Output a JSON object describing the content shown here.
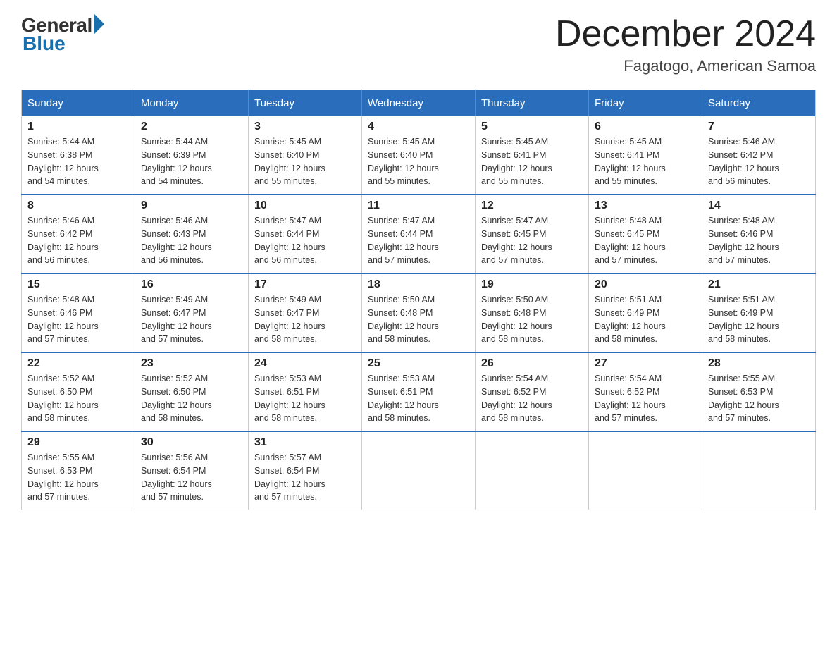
{
  "logo": {
    "general": "General",
    "blue": "Blue"
  },
  "title": {
    "month_year": "December 2024",
    "location": "Fagatogo, American Samoa"
  },
  "weekdays": [
    "Sunday",
    "Monday",
    "Tuesday",
    "Wednesday",
    "Thursday",
    "Friday",
    "Saturday"
  ],
  "weeks": [
    [
      {
        "day": "1",
        "sunrise": "5:44 AM",
        "sunset": "6:38 PM",
        "daylight": "12 hours and 54 minutes."
      },
      {
        "day": "2",
        "sunrise": "5:44 AM",
        "sunset": "6:39 PM",
        "daylight": "12 hours and 54 minutes."
      },
      {
        "day": "3",
        "sunrise": "5:45 AM",
        "sunset": "6:40 PM",
        "daylight": "12 hours and 55 minutes."
      },
      {
        "day": "4",
        "sunrise": "5:45 AM",
        "sunset": "6:40 PM",
        "daylight": "12 hours and 55 minutes."
      },
      {
        "day": "5",
        "sunrise": "5:45 AM",
        "sunset": "6:41 PM",
        "daylight": "12 hours and 55 minutes."
      },
      {
        "day": "6",
        "sunrise": "5:45 AM",
        "sunset": "6:41 PM",
        "daylight": "12 hours and 55 minutes."
      },
      {
        "day": "7",
        "sunrise": "5:46 AM",
        "sunset": "6:42 PM",
        "daylight": "12 hours and 56 minutes."
      }
    ],
    [
      {
        "day": "8",
        "sunrise": "5:46 AM",
        "sunset": "6:42 PM",
        "daylight": "12 hours and 56 minutes."
      },
      {
        "day": "9",
        "sunrise": "5:46 AM",
        "sunset": "6:43 PM",
        "daylight": "12 hours and 56 minutes."
      },
      {
        "day": "10",
        "sunrise": "5:47 AM",
        "sunset": "6:44 PM",
        "daylight": "12 hours and 56 minutes."
      },
      {
        "day": "11",
        "sunrise": "5:47 AM",
        "sunset": "6:44 PM",
        "daylight": "12 hours and 57 minutes."
      },
      {
        "day": "12",
        "sunrise": "5:47 AM",
        "sunset": "6:45 PM",
        "daylight": "12 hours and 57 minutes."
      },
      {
        "day": "13",
        "sunrise": "5:48 AM",
        "sunset": "6:45 PM",
        "daylight": "12 hours and 57 minutes."
      },
      {
        "day": "14",
        "sunrise": "5:48 AM",
        "sunset": "6:46 PM",
        "daylight": "12 hours and 57 minutes."
      }
    ],
    [
      {
        "day": "15",
        "sunrise": "5:48 AM",
        "sunset": "6:46 PM",
        "daylight": "12 hours and 57 minutes."
      },
      {
        "day": "16",
        "sunrise": "5:49 AM",
        "sunset": "6:47 PM",
        "daylight": "12 hours and 57 minutes."
      },
      {
        "day": "17",
        "sunrise": "5:49 AM",
        "sunset": "6:47 PM",
        "daylight": "12 hours and 58 minutes."
      },
      {
        "day": "18",
        "sunrise": "5:50 AM",
        "sunset": "6:48 PM",
        "daylight": "12 hours and 58 minutes."
      },
      {
        "day": "19",
        "sunrise": "5:50 AM",
        "sunset": "6:48 PM",
        "daylight": "12 hours and 58 minutes."
      },
      {
        "day": "20",
        "sunrise": "5:51 AM",
        "sunset": "6:49 PM",
        "daylight": "12 hours and 58 minutes."
      },
      {
        "day": "21",
        "sunrise": "5:51 AM",
        "sunset": "6:49 PM",
        "daylight": "12 hours and 58 minutes."
      }
    ],
    [
      {
        "day": "22",
        "sunrise": "5:52 AM",
        "sunset": "6:50 PM",
        "daylight": "12 hours and 58 minutes."
      },
      {
        "day": "23",
        "sunrise": "5:52 AM",
        "sunset": "6:50 PM",
        "daylight": "12 hours and 58 minutes."
      },
      {
        "day": "24",
        "sunrise": "5:53 AM",
        "sunset": "6:51 PM",
        "daylight": "12 hours and 58 minutes."
      },
      {
        "day": "25",
        "sunrise": "5:53 AM",
        "sunset": "6:51 PM",
        "daylight": "12 hours and 58 minutes."
      },
      {
        "day": "26",
        "sunrise": "5:54 AM",
        "sunset": "6:52 PM",
        "daylight": "12 hours and 58 minutes."
      },
      {
        "day": "27",
        "sunrise": "5:54 AM",
        "sunset": "6:52 PM",
        "daylight": "12 hours and 57 minutes."
      },
      {
        "day": "28",
        "sunrise": "5:55 AM",
        "sunset": "6:53 PM",
        "daylight": "12 hours and 57 minutes."
      }
    ],
    [
      {
        "day": "29",
        "sunrise": "5:55 AM",
        "sunset": "6:53 PM",
        "daylight": "12 hours and 57 minutes."
      },
      {
        "day": "30",
        "sunrise": "5:56 AM",
        "sunset": "6:54 PM",
        "daylight": "12 hours and 57 minutes."
      },
      {
        "day": "31",
        "sunrise": "5:57 AM",
        "sunset": "6:54 PM",
        "daylight": "12 hours and 57 minutes."
      },
      null,
      null,
      null,
      null
    ]
  ],
  "labels": {
    "sunrise": "Sunrise:",
    "sunset": "Sunset:",
    "daylight": "Daylight:"
  }
}
